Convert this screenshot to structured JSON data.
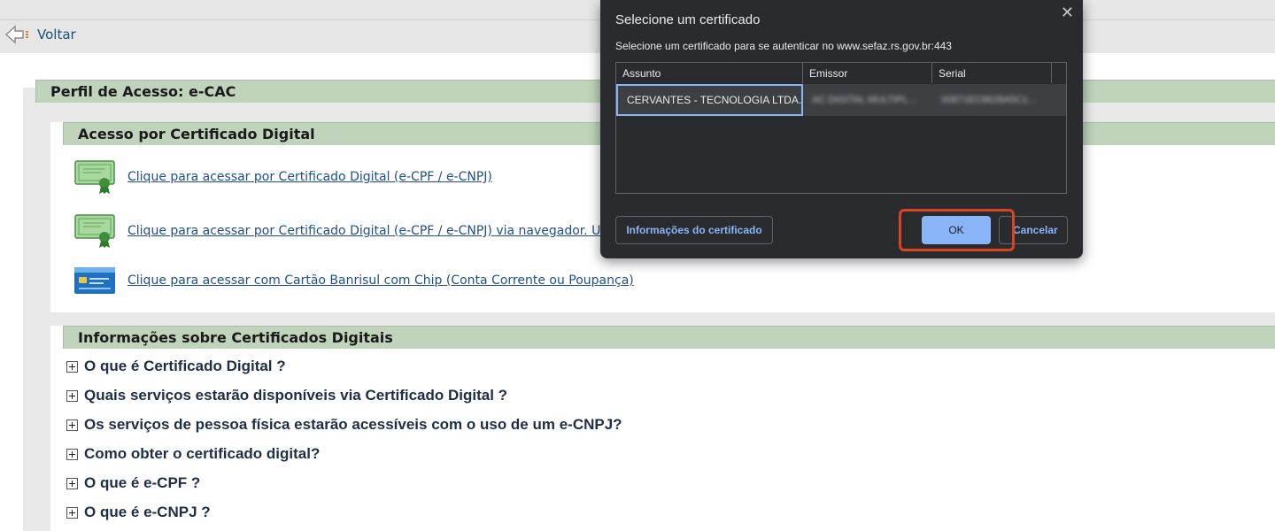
{
  "nav": {
    "back_label": "Voltar"
  },
  "profile": {
    "title": "Perfil de Acesso: e-CAC"
  },
  "access": {
    "title": "Acesso por Certificado Digital",
    "items": [
      {
        "label": "Clique para acessar por Certificado Digital (e-CPF / e-CNPJ)",
        "icon": "certificate-icon"
      },
      {
        "label": "Clique para acessar por Certificado Digital (e-CPF / e-CNPJ) via navegador. Uti",
        "icon": "certificate-icon"
      },
      {
        "label": "Clique para acessar com Cartão Banrisul com Chip (Conta Corrente ou Poupança)",
        "icon": "bank-card-icon"
      }
    ]
  },
  "info": {
    "title": "Informações sobre Certificados Digitais",
    "items": [
      "O que é Certificado Digital ?",
      "Quais serviços estarão disponíveis via Certificado Digital ?",
      "Os serviços de pessoa física estarão acessíveis com o uso de um e-CNPJ?",
      "Como obter o certificado digital?",
      "O que é e-CPF ?",
      "O que é e-CNPJ ?"
    ]
  },
  "dialog": {
    "title": "Selecione um certificado",
    "subtitle": "Selecione um certificado para se autenticar no www.sefaz.rs.gov.br:443",
    "columns": [
      "Assunto",
      "Emissor",
      "Serial"
    ],
    "row": {
      "subject": "CERVANTES - TECNOLOGIA LTDA...",
      "issuer": "AC DIGITAL MULTIPL...",
      "serial": "00871EC8628A5C1..."
    },
    "info_button": "Informações do certificado",
    "ok_button": "OK",
    "cancel_button": "Cancelar"
  },
  "colors": {
    "section_header": "#bfd4bb",
    "link": "#1f4f88",
    "dialog_bg": "#2a2b2e",
    "accent": "#8ab4f8",
    "highlight": "#d9451f"
  }
}
